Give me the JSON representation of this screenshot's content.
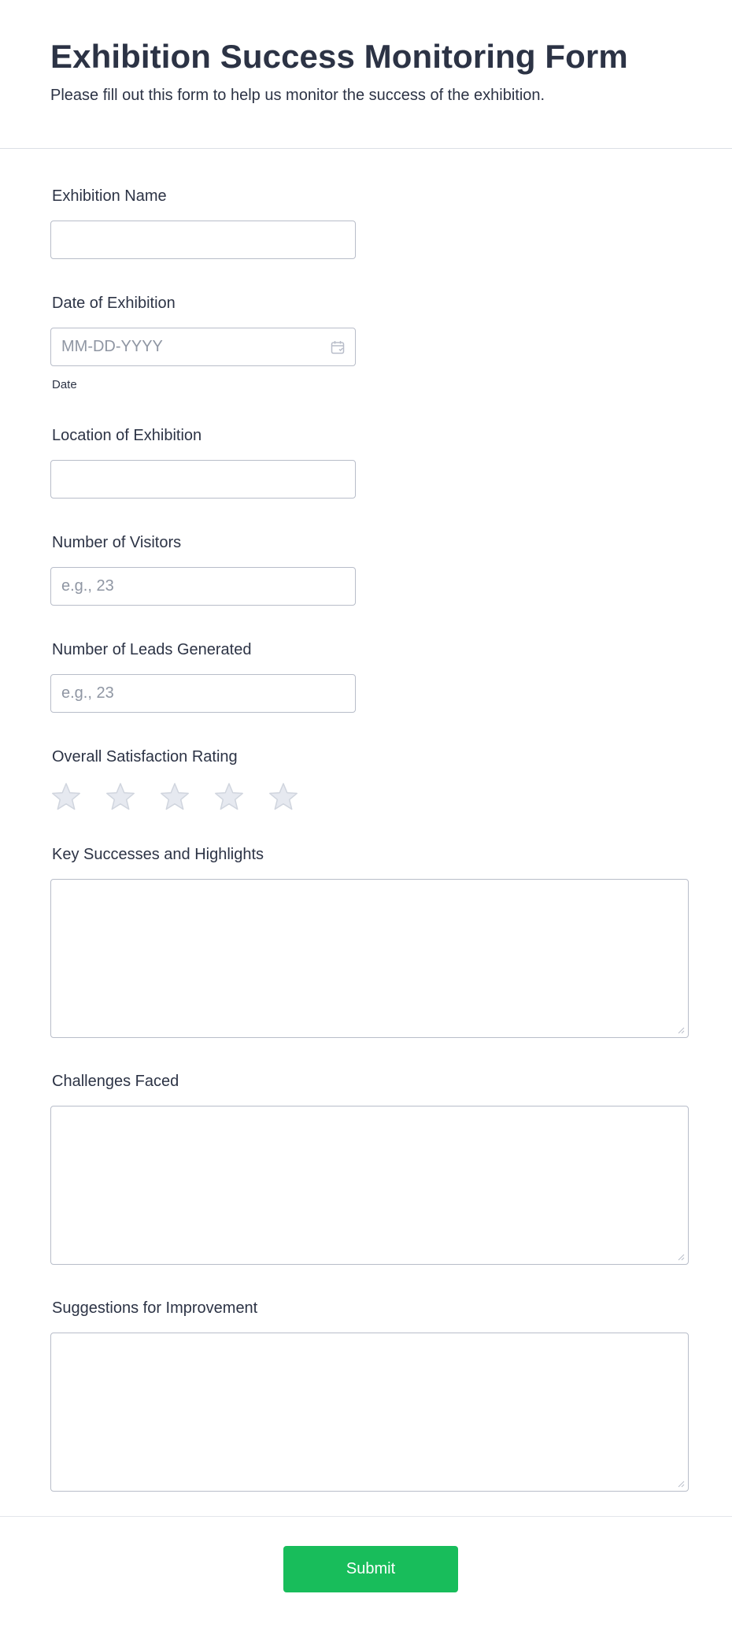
{
  "header": {
    "title": "Exhibition Success Monitoring Form",
    "subtitle": "Please fill out this form to help us monitor the success of the exhibition."
  },
  "fields": {
    "exhibition_name": {
      "label": "Exhibition Name",
      "value": "",
      "placeholder": ""
    },
    "date_of_exhibition": {
      "label": "Date of Exhibition",
      "value": "",
      "placeholder": "MM-DD-YYYY",
      "sublabel": "Date",
      "icon": "calendar-icon"
    },
    "location_of_exhibition": {
      "label": "Location of Exhibition",
      "value": "",
      "placeholder": ""
    },
    "number_of_visitors": {
      "label": "Number of Visitors",
      "value": "",
      "placeholder": "e.g., 23"
    },
    "number_of_leads": {
      "label": "Number of Leads Generated",
      "value": "",
      "placeholder": "e.g., 23"
    },
    "satisfaction_rating": {
      "label": "Overall Satisfaction Rating",
      "max": 5,
      "value": 0,
      "icon": "star-icon"
    },
    "key_successes": {
      "label": "Key Successes and Highlights",
      "value": ""
    },
    "challenges_faced": {
      "label": "Challenges Faced",
      "value": ""
    },
    "suggestions": {
      "label": "Suggestions for Improvement",
      "value": ""
    }
  },
  "footer": {
    "submit_label": "Submit"
  },
  "colors": {
    "text": "#2c3345",
    "placeholder": "#8f96a3",
    "border": "#b8bdc9",
    "star_fill": "#e6e9f0",
    "star_stroke": "#d0d5de",
    "submit_bg": "#18bd5b"
  }
}
